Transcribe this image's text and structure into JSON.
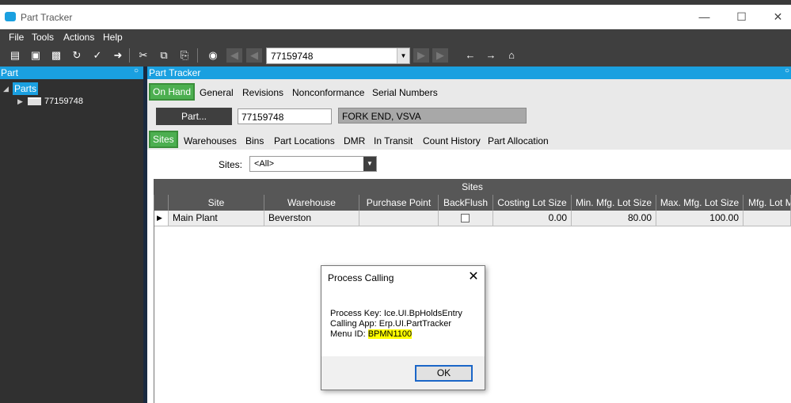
{
  "window": {
    "title": "Part Tracker",
    "minimize": "—",
    "maximize": "☐",
    "close": "✕"
  },
  "menu": {
    "items": [
      "File",
      "Tools",
      "Actions",
      "Help"
    ]
  },
  "toolbar": {
    "nav_value": "77159748"
  },
  "left_panel": {
    "header": "Part",
    "tree_root": "Parts",
    "tree_child": "77159748"
  },
  "right_panel": {
    "header": "Part Tracker"
  },
  "tabs_main": [
    "On Hand",
    "General",
    "Revisions",
    "Nonconformance",
    "Serial Numbers"
  ],
  "part": {
    "button": "Part...",
    "number": "77159748",
    "description": "FORK END, VSVA"
  },
  "tabs_sub": [
    "Sites",
    "Warehouses",
    "Bins",
    "Part Locations",
    "DMR",
    "In Transit",
    "Count History",
    "Part Allocation"
  ],
  "sites_filter": {
    "label": "Sites:",
    "value": "<All>"
  },
  "grid": {
    "title": "Sites",
    "columns": [
      "Site",
      "Warehouse",
      "Purchase Point",
      "BackFlush",
      "Costing Lot Size",
      "Min. Mfg. Lot Size",
      "Max. Mfg. Lot Size",
      "Mfg. Lot M"
    ],
    "row": {
      "site": "Main Plant",
      "warehouse": "Beverston",
      "purchase_point": "",
      "costing_lot_size": "0.00",
      "min_mfg": "80.00",
      "max_mfg": "100.00",
      "mfg_lot": ""
    }
  },
  "dialog": {
    "title": "Process Calling",
    "line1": "Process Key: Ice.UI.BpHoldsEntry",
    "line2": "Calling App: Erp.UI.PartTracker",
    "line3_label": "Menu ID: ",
    "line3_value": "BPMN1100",
    "ok": "OK"
  },
  "colors": {
    "accent": "#1aa0e0",
    "selected_tab": "#4caf50",
    "dark": "#3f3f3f",
    "highlight": "#ffff00"
  }
}
